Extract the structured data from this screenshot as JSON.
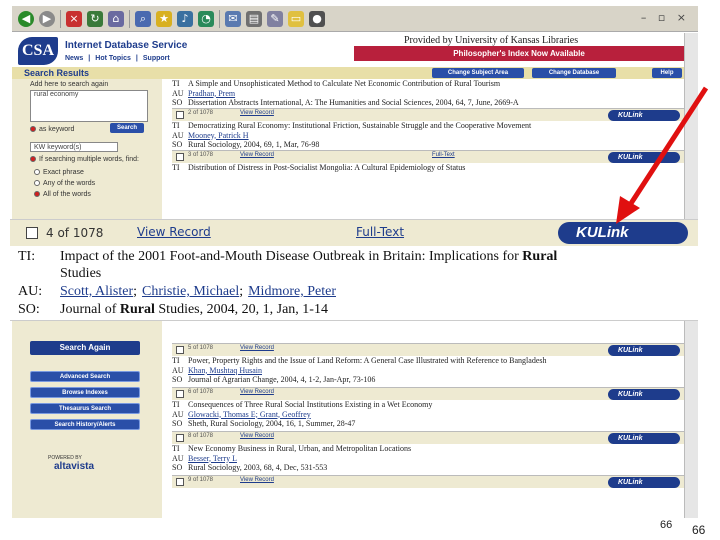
{
  "browser": {
    "window_controls": "– ▫ ×",
    "icons": [
      "back-icon",
      "forward-icon",
      "stop-icon",
      "refresh-icon",
      "home-icon",
      "search-icon",
      "favorites-icon",
      "media-icon",
      "history-icon",
      "mail-icon",
      "print-icon",
      "edit-icon",
      "folder-icon",
      "messenger-icon"
    ]
  },
  "header": {
    "logo": "CSA",
    "service_title": "Internet Database Service",
    "links": [
      "News",
      "Hot Topics",
      "Support"
    ],
    "provided_by": "Provided by University of Kansas Libraries",
    "banner": "Philosopher's Index Now Available"
  },
  "nav": {
    "title": "Search Results",
    "buttons": [
      "Change Subject Area",
      "Change Database",
      "Help"
    ]
  },
  "left_panel": {
    "hint": "Add here to search again",
    "query": "rural economy",
    "option_keyword": "as keyword",
    "search_button": "Search",
    "field_select": "KW keyword(s)",
    "multi_words": "If searching multiple words, find:",
    "opt_exact": "Exact phrase",
    "opt_any": "Any of the words",
    "opt_all": "All of the words",
    "search_again": "Search Again",
    "tools": [
      "Advanced Search",
      "Browse Indexes",
      "Thesaurus Search",
      "Search History/Alerts"
    ],
    "powered_by": "POWERED BY",
    "altavista": "altavista"
  },
  "records_top": [
    {
      "ti": "A Simple and Unsophisticated Method to Calculate Net Economic Contribution of Rural Tourism",
      "au": "Pradhan, Prem",
      "so": "Dissertation Abstracts International, A: The Humanities and Social Sciences, 2004, 64, 7, June, 2669-A",
      "bar": {
        "num": "2 of 1078",
        "view": "View Record",
        "fulltext": ""
      }
    },
    {
      "ti": "Democratizing Rural Economy: Institutional Friction, Sustainable Struggle and the Cooperative Movement",
      "au": "Mooney, Patrick H",
      "so": "Rural Sociology, 2004, 69, 1, Mar, 76-98",
      "bar": {
        "num": "3 of 1078",
        "view": "View Record",
        "fulltext": "Full-Text"
      }
    },
    {
      "ti": "Distribution of Distress in Post-Socialist Mongolia: A Cultural Epidemiology of Status",
      "au": "",
      "so": "",
      "bar": null
    }
  ],
  "zoom_record": {
    "num": "4 of 1078",
    "view": "View Record",
    "fulltext": "Full-Text",
    "kulink": "KULink",
    "ti_label": "TI:",
    "ti_plain": "Impact of the 2001 Foot-and-Mouth Disease Outbreak in Britain: Implications for",
    "ti_bold": "Rural",
    "ti_cont": "Studies",
    "au_label": "AU:",
    "authors": [
      "Scott, Alister",
      "Christie, Michael",
      "Midmore, Peter"
    ],
    "so_label": "SO:",
    "so_pre": "Journal of",
    "so_bold": "Rural",
    "so_post": "Studies, 2004, 20, 1, Jan, 1-14"
  },
  "records_bottom": [
    {
      "bar": {
        "num": "5 of 1078",
        "view": "View Record",
        "fulltext": ""
      },
      "ti": "Power, Property Rights and the Issue of Land Reform: A General Case Illustrated with Reference to Bangladesh",
      "au": "Khan, Mushtaq Husain",
      "so": "Journal of Agrarian Change, 2004, 4, 1-2, Jan-Apr, 73-106"
    },
    {
      "bar": {
        "num": "6 of 1078",
        "view": "View Record",
        "fulltext": ""
      },
      "ti": "Consequences of Three Rural Social Institutions Existing in a Wet Economy",
      "au": "Glowacki, Thomas E; Grant, Geoffrey",
      "so": "Sheth, Rural Sociology, 2004, 16, 1, Summer, 28-47"
    },
    {
      "bar": {
        "num": "8 of 1078",
        "view": "View Record",
        "fulltext": ""
      },
      "ti": "New Economy Business in Rural, Urban, and Metropolitan Locations",
      "au": "Besser, Terry L",
      "so": "Rural Sociology, 2003, 68, 4, Dec, 531-553"
    },
    {
      "bar": {
        "num": "9 of 1078",
        "view": "View Record",
        "fulltext": ""
      },
      "ti": "",
      "au": "",
      "so": ""
    }
  ],
  "labels": {
    "ti": "TI",
    "au": "AU",
    "so": "SO",
    "kulink": "KULink"
  },
  "page_numbers": {
    "inner": "66",
    "outer": "66"
  },
  "colors": {
    "arrow": "#e01010",
    "accent": "#1e3c8c",
    "banner": "#b8203c"
  }
}
